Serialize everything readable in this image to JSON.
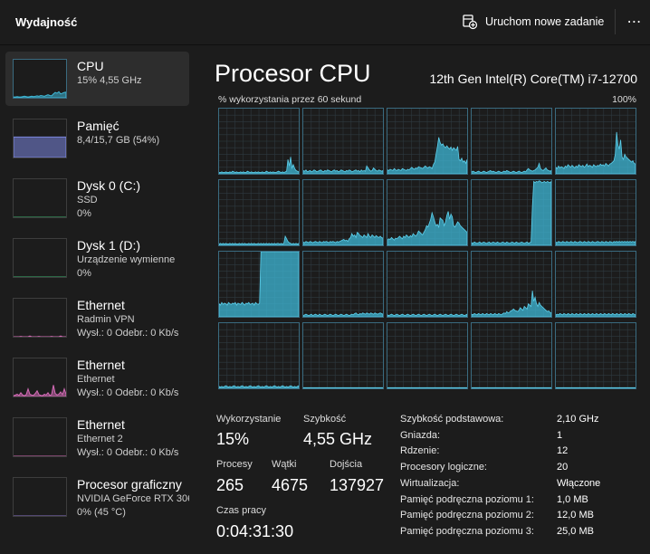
{
  "header": {
    "title": "Wydajność",
    "run_task_label": "Uruchom nowe zadanie",
    "more_label": "⋯"
  },
  "sidebar": {
    "items": [
      {
        "title": "CPU",
        "lines": [
          "15% 4,55 GHz"
        ],
        "color": "#3eb7d6",
        "selected": true
      },
      {
        "title": "Pamięć",
        "lines": [
          "8,4/15,7 GB (54%)"
        ],
        "color": "#7b86e0",
        "selected": false
      },
      {
        "title": "Dysk 0 (C:)",
        "lines": [
          "SSD",
          "0%"
        ],
        "color": "#3cb66f",
        "selected": false
      },
      {
        "title": "Dysk 1 (D:)",
        "lines": [
          "Urządzenie wymienne",
          "0%"
        ],
        "color": "#3cb66f",
        "selected": false
      },
      {
        "title": "Ethernet",
        "lines": [
          "Radmin VPN",
          "Wysł.: 0 Odebr.: 0 Kb/s"
        ],
        "color": "#d36bb6",
        "selected": false
      },
      {
        "title": "Ethernet",
        "lines": [
          "Ethernet",
          "Wysł.: 0 Odebr.: 0 Kb/s"
        ],
        "color": "#d36bb6",
        "selected": false
      },
      {
        "title": "Ethernet",
        "lines": [
          "Ethernet 2",
          "Wysł.: 0 Odebr.: 0 Kb/s"
        ],
        "color": "#d36bb6",
        "selected": false
      },
      {
        "title": "Procesor graficzny",
        "lines": [
          "NVIDIA GeForce RTX 306",
          "0% (45 °C)"
        ],
        "color": "#8a75c8",
        "selected": false
      }
    ]
  },
  "main": {
    "title": "Procesor CPU",
    "model": "12th Gen Intel(R) Core(TM) i7-12700",
    "graph_label": "% wykorzystania przez 60 sekund",
    "graph_max": "100%",
    "accent_color": "#3eb7d6"
  },
  "stats": {
    "utilization_label": "Wykorzystanie",
    "utilization_value": "15%",
    "speed_label": "Szybkość",
    "speed_value": "4,55 GHz",
    "processes_label": "Procesy",
    "processes_value": "265",
    "threads_label": "Wątki",
    "threads_value": "4675",
    "handles_label": "Dojścia",
    "handles_value": "137927",
    "uptime_label": "Czas pracy",
    "uptime_value": "0:04:31:30"
  },
  "specs": [
    {
      "label": "Szybkość podstawowa:",
      "value": "2,10 GHz"
    },
    {
      "label": "Gniazda:",
      "value": "1"
    },
    {
      "label": "Rdzenie:",
      "value": "12"
    },
    {
      "label": "Procesory logiczne:",
      "value": "20"
    },
    {
      "label": "Wirtualizacja:",
      "value": "Włączone"
    },
    {
      "label": "Pamięć podręczna poziomu 1:",
      "value": "1,0 MB"
    },
    {
      "label": "Pamięć podręczna poziomu 2:",
      "value": "12,0 MB"
    },
    {
      "label": "Pamięć podręczna poziomu 3:",
      "value": "25,0 MB"
    }
  ],
  "cpu_cores": [
    [
      2,
      2,
      3,
      2,
      2,
      3,
      2,
      2,
      3,
      2,
      4,
      3,
      2,
      3,
      2,
      2,
      3,
      2,
      3,
      2,
      2,
      4,
      3,
      2,
      3,
      2,
      2,
      3,
      2,
      3,
      2,
      2,
      3,
      2,
      2,
      4,
      3,
      2,
      3,
      2,
      3,
      2,
      2,
      3,
      4,
      3,
      2,
      3,
      2,
      3,
      4,
      22,
      12,
      26,
      9,
      14,
      8,
      5,
      4,
      3
    ],
    [
      5,
      4,
      6,
      3,
      4,
      5,
      3,
      4,
      6,
      5,
      3,
      4,
      5,
      6,
      4,
      3,
      5,
      4,
      6,
      5,
      4,
      3,
      5,
      6,
      4,
      5,
      3,
      4,
      6,
      5,
      4,
      3,
      5,
      4,
      6,
      5,
      3,
      4,
      5,
      6,
      4,
      5,
      3,
      6,
      4,
      5,
      4,
      12,
      9,
      6,
      4,
      5,
      9,
      7,
      5,
      4,
      6,
      5,
      4,
      5
    ],
    [
      6,
      5,
      7,
      6,
      5,
      8,
      6,
      5,
      7,
      6,
      5,
      8,
      7,
      6,
      5,
      7,
      6,
      8,
      10,
      8,
      7,
      9,
      8,
      11,
      10,
      9,
      8,
      10,
      12,
      10,
      9,
      11,
      10,
      8,
      14,
      18,
      30,
      42,
      56,
      48,
      44,
      46,
      42,
      40,
      43,
      40,
      38,
      41,
      36,
      40,
      38,
      36,
      42,
      22,
      20,
      24,
      18,
      20,
      16,
      22
    ],
    [
      3,
      4,
      3,
      2,
      3,
      4,
      3,
      2,
      3,
      4,
      3,
      2,
      3,
      4,
      5,
      3,
      4,
      3,
      2,
      3,
      4,
      3,
      2,
      3,
      4,
      3,
      5,
      4,
      3,
      2,
      3,
      4,
      3,
      2,
      3,
      4,
      3,
      2,
      3,
      4,
      3,
      6,
      8,
      6,
      5,
      4,
      5,
      6,
      8,
      10,
      16,
      8,
      6,
      5,
      7,
      9,
      6,
      5,
      4,
      5
    ],
    [
      10,
      8,
      12,
      9,
      11,
      10,
      8,
      12,
      10,
      14,
      12,
      10,
      13,
      11,
      9,
      12,
      10,
      14,
      12,
      11,
      13,
      10,
      12,
      15,
      11,
      13,
      12,
      10,
      14,
      12,
      11,
      13,
      12,
      15,
      13,
      14,
      12,
      16,
      14,
      12,
      15,
      16,
      18,
      20,
      30,
      64,
      44,
      38,
      52,
      26,
      22,
      30,
      26,
      24,
      22,
      20,
      18,
      20,
      16,
      15
    ],
    [
      2,
      3,
      2,
      3,
      2,
      3,
      2,
      2,
      3,
      2,
      3,
      2,
      3,
      2,
      2,
      3,
      2,
      3,
      2,
      3,
      2,
      2,
      3,
      2,
      3,
      2,
      3,
      2,
      2,
      3,
      2,
      3,
      2,
      3,
      2,
      3,
      2,
      3,
      2,
      3,
      2,
      3,
      2,
      3,
      3,
      2,
      3,
      2,
      3,
      14,
      10,
      6,
      4,
      3,
      2,
      3,
      2,
      3,
      2,
      3
    ],
    [
      5,
      4,
      6,
      5,
      4,
      6,
      5,
      4,
      5,
      6,
      5,
      4,
      6,
      5,
      4,
      6,
      5,
      6,
      5,
      4,
      6,
      5,
      6,
      5,
      4,
      6,
      5,
      6,
      7,
      8,
      9,
      7,
      8,
      6,
      10,
      12,
      18,
      14,
      16,
      12,
      20,
      18,
      15,
      14,
      12,
      16,
      14,
      12,
      18,
      14,
      12,
      16,
      14,
      12,
      15,
      13,
      12,
      14,
      12,
      11
    ],
    [
      8,
      10,
      9,
      12,
      10,
      8,
      11,
      10,
      12,
      14,
      12,
      10,
      14,
      12,
      16,
      14,
      12,
      15,
      13,
      18,
      16,
      14,
      17,
      22,
      20,
      18,
      16,
      20,
      24,
      30,
      28,
      34,
      40,
      50,
      44,
      36,
      30,
      32,
      28,
      42,
      40,
      38,
      30,
      36,
      46,
      52,
      40,
      48,
      44,
      30,
      28,
      32,
      36,
      34,
      30,
      28,
      26,
      24,
      22,
      20
    ],
    [
      4,
      3,
      5,
      4,
      3,
      4,
      5,
      3,
      4,
      5,
      4,
      3,
      4,
      5,
      3,
      4,
      5,
      4,
      3,
      5,
      4,
      3,
      4,
      5,
      4,
      3,
      5,
      4,
      3,
      4,
      5,
      4,
      3,
      5,
      4,
      3,
      4,
      5,
      4,
      3,
      4,
      5,
      3,
      4,
      5,
      60,
      98,
      96,
      98,
      97,
      99,
      98,
      96,
      97,
      98,
      96,
      98,
      97,
      96,
      98
    ],
    [
      5,
      4,
      6,
      5,
      4,
      6,
      5,
      4,
      6,
      5,
      4,
      6,
      5,
      4,
      6,
      5,
      4,
      5,
      6,
      5,
      4,
      6,
      5,
      4,
      6,
      5,
      4,
      6,
      5,
      4,
      5,
      6,
      5,
      4,
      6,
      5,
      4,
      6,
      5,
      4,
      6,
      5,
      4,
      6,
      5,
      6,
      5,
      6,
      5,
      6,
      5,
      6,
      5,
      6,
      5,
      6,
      5,
      6,
      5,
      6
    ],
    [
      20,
      18,
      22,
      19,
      21,
      20,
      18,
      22,
      20,
      19,
      21,
      20,
      22,
      18,
      21,
      20,
      19,
      22,
      20,
      18,
      21,
      20,
      22,
      19,
      20,
      21,
      18,
      22,
      20,
      19,
      21,
      100,
      100,
      100,
      100,
      100,
      100,
      100,
      100,
      100,
      100,
      100,
      100,
      100,
      100,
      100,
      100,
      100,
      100,
      100,
      100,
      100,
      100,
      100,
      100,
      100,
      100,
      100,
      100,
      100
    ],
    [
      2,
      3,
      4,
      3,
      2,
      3,
      4,
      2,
      3,
      4,
      3,
      2,
      4,
      3,
      2,
      3,
      4,
      3,
      2,
      3,
      4,
      3,
      2,
      3,
      4,
      3,
      2,
      3,
      4,
      3,
      2,
      3,
      4,
      3,
      2,
      3,
      4,
      3,
      5,
      6,
      4,
      3,
      5,
      4,
      6,
      5,
      4,
      6,
      5,
      4,
      6,
      5,
      4,
      6,
      5,
      4,
      5,
      6,
      5,
      4
    ],
    [
      3,
      2,
      3,
      4,
      3,
      2,
      3,
      4,
      3,
      2,
      3,
      4,
      3,
      2,
      3,
      4,
      3,
      2,
      3,
      4,
      3,
      2,
      3,
      4,
      3,
      2,
      3,
      4,
      3,
      2,
      3,
      4,
      3,
      2,
      3,
      4,
      3,
      2,
      3,
      4,
      3,
      2,
      3,
      4,
      3,
      2,
      3,
      4,
      3,
      2,
      3,
      4,
      3,
      2,
      3,
      4,
      3,
      2,
      3,
      4
    ],
    [
      4,
      3,
      5,
      4,
      3,
      5,
      4,
      3,
      5,
      4,
      3,
      5,
      4,
      3,
      5,
      4,
      3,
      5,
      4,
      3,
      5,
      4,
      3,
      5,
      6,
      5,
      8,
      6,
      7,
      9,
      10,
      12,
      10,
      9,
      8,
      10,
      14,
      12,
      10,
      16,
      14,
      12,
      20,
      18,
      16,
      40,
      24,
      30,
      20,
      16,
      22,
      18,
      16,
      14,
      12,
      10,
      8,
      9,
      7,
      6
    ],
    [
      3,
      4,
      3,
      5,
      4,
      3,
      5,
      4,
      3,
      5,
      4,
      3,
      5,
      4,
      3,
      5,
      4,
      3,
      5,
      4,
      3,
      5,
      4,
      3,
      5,
      4,
      3,
      5,
      4,
      3,
      5,
      4,
      3,
      5,
      4,
      3,
      5,
      4,
      3,
      5,
      4,
      3,
      5,
      4,
      3,
      5,
      4,
      3,
      5,
      4,
      3,
      5,
      4,
      3,
      5,
      4,
      3,
      5,
      4,
      3
    ],
    [
      3,
      2,
      3,
      2,
      3,
      4,
      3,
      2,
      3,
      2,
      3,
      4,
      3,
      2,
      3,
      2,
      3,
      4,
      3,
      2,
      3,
      2,
      3,
      4,
      3,
      2,
      3,
      2,
      3,
      4,
      3,
      2,
      3,
      2,
      3,
      4,
      3,
      2,
      3,
      2,
      3,
      4,
      3,
      2,
      3,
      2,
      3,
      4,
      3,
      2,
      3,
      2,
      3,
      4,
      3,
      2,
      3,
      2,
      3,
      4
    ],
    [
      1,
      1,
      1,
      1,
      1,
      1,
      1,
      1,
      1,
      1,
      1,
      1,
      1,
      1,
      1,
      1,
      1,
      1,
      1,
      1,
      1,
      1,
      1,
      1,
      1,
      1,
      1,
      1,
      1,
      1,
      1,
      1,
      1,
      1,
      1,
      1,
      1,
      1,
      1,
      1,
      1,
      1,
      1,
      1,
      1,
      1,
      1,
      1,
      1,
      1,
      1,
      1,
      1,
      1,
      1,
      1,
      1,
      1,
      1,
      1
    ],
    [
      1,
      1,
      1,
      1,
      1,
      1,
      1,
      1,
      1,
      1,
      1,
      1,
      1,
      1,
      1,
      1,
      1,
      1,
      1,
      1,
      1,
      1,
      1,
      1,
      1,
      1,
      1,
      1,
      1,
      1,
      1,
      1,
      1,
      1,
      1,
      1,
      1,
      1,
      1,
      1,
      1,
      1,
      1,
      1,
      1,
      1,
      1,
      1,
      1,
      1,
      1,
      1,
      1,
      1,
      1,
      1,
      1,
      1,
      1,
      1
    ],
    [
      1,
      1,
      1,
      1,
      1,
      1,
      1,
      1,
      1,
      1,
      1,
      1,
      1,
      1,
      1,
      1,
      1,
      1,
      1,
      1,
      1,
      1,
      1,
      1,
      1,
      1,
      1,
      1,
      1,
      1,
      1,
      1,
      1,
      1,
      1,
      1,
      1,
      1,
      1,
      1,
      1,
      1,
      1,
      1,
      1,
      1,
      1,
      1,
      1,
      1,
      1,
      1,
      1,
      1,
      1,
      1,
      1,
      1,
      1,
      1
    ],
    [
      1,
      1,
      1,
      1,
      1,
      1,
      1,
      1,
      1,
      1,
      1,
      1,
      1,
      1,
      1,
      1,
      1,
      1,
      1,
      1,
      1,
      1,
      1,
      1,
      1,
      1,
      1,
      1,
      1,
      1,
      1,
      1,
      1,
      1,
      1,
      1,
      1,
      1,
      1,
      1,
      1,
      1,
      1,
      1,
      1,
      1,
      1,
      1,
      1,
      1,
      1,
      1,
      1,
      1,
      1,
      1,
      1,
      1,
      1,
      1
    ]
  ],
  "sidebar_graphs": [
    [
      2,
      2,
      3,
      2,
      2,
      3,
      4,
      3,
      2,
      3,
      4,
      3,
      4,
      5,
      4,
      6,
      5,
      4,
      6,
      8,
      6,
      5,
      10,
      14,
      12,
      16,
      10,
      12,
      14,
      15
    ],
    [
      54,
      54,
      54,
      54,
      54,
      54,
      54,
      54,
      54,
      54,
      54,
      54,
      54,
      54,
      54,
      54,
      54,
      54,
      54,
      54,
      54,
      54,
      54,
      54,
      54,
      54,
      54,
      54,
      54,
      54
    ],
    [
      0,
      0,
      0,
      0,
      0,
      0,
      0,
      0,
      0,
      0,
      0,
      0,
      0,
      0,
      0,
      0,
      0,
      0,
      0,
      0,
      0,
      0,
      0,
      0,
      0,
      0,
      0,
      0,
      0,
      0
    ],
    [
      0,
      0,
      0,
      0,
      0,
      0,
      0,
      0,
      0,
      0,
      0,
      0,
      0,
      0,
      0,
      0,
      0,
      0,
      0,
      0,
      0,
      0,
      0,
      0,
      0,
      0,
      0,
      0,
      0,
      0
    ],
    [
      0,
      0,
      0,
      0,
      1,
      0,
      0,
      0,
      0,
      2,
      0,
      0,
      0,
      0,
      1,
      0,
      0,
      0,
      0,
      0,
      0,
      1,
      0,
      0,
      0,
      0,
      2,
      0,
      0,
      0
    ],
    [
      2,
      4,
      6,
      3,
      10,
      4,
      2,
      5,
      20,
      6,
      4,
      3,
      8,
      15,
      5,
      3,
      2,
      6,
      4,
      10,
      3,
      5,
      30,
      8,
      4,
      6,
      12,
      5,
      20,
      6
    ],
    [
      0,
      0,
      0,
      0,
      0,
      0,
      0,
      0,
      0,
      0,
      0,
      0,
      0,
      0,
      0,
      0,
      0,
      0,
      0,
      0,
      0,
      0,
      0,
      0,
      0,
      0,
      0,
      0,
      0,
      0
    ],
    [
      0,
      0,
      0,
      0,
      0,
      0,
      0,
      0,
      0,
      0,
      0,
      0,
      0,
      0,
      0,
      0,
      0,
      0,
      0,
      0,
      0,
      0,
      0,
      0,
      0,
      0,
      0,
      0,
      0,
      0
    ]
  ]
}
